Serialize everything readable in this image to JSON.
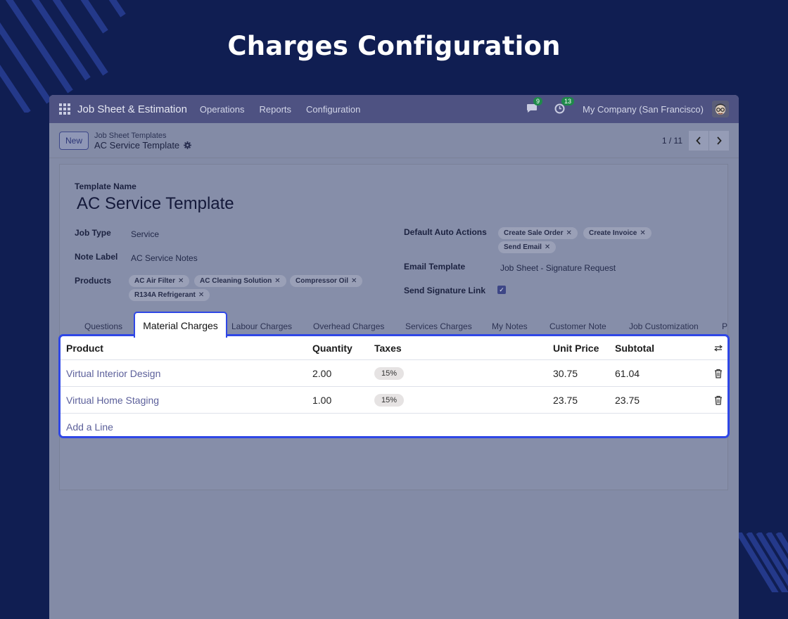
{
  "headline": "Charges Configuration",
  "navbar": {
    "app_name": "Job Sheet & Estimation",
    "menu": [
      "Operations",
      "Reports",
      "Configuration"
    ],
    "messages_count": "9",
    "activities_count": "13",
    "company": "My Company (San Francisco)"
  },
  "control": {
    "new_label": "New",
    "breadcrumb_parent": "Job Sheet Templates",
    "breadcrumb_current": "AC Service Template",
    "pager": "1 / 11"
  },
  "form": {
    "template_name_label": "Template Name",
    "template_name": "AC Service Template",
    "job_type_label": "Job Type",
    "job_type": "Service",
    "note_label_label": "Note Label",
    "note_label": "AC Service Notes",
    "products_label": "Products",
    "products": [
      "AC Air Filter",
      "AC Cleaning Solution",
      "Compressor Oil",
      "R134A Refrigerant"
    ],
    "default_auto_actions_label": "Default Auto Actions",
    "auto_actions": [
      "Create Sale Order",
      "Create Invoice",
      "Send Email"
    ],
    "email_template_label": "Email Template",
    "email_template": "Job Sheet - Signature Request",
    "send_signature_label": "Send Signature Link",
    "send_signature_checked": true
  },
  "tabs": [
    "Questions",
    "Material Charges",
    "Labour Charges",
    "Overhead Charges",
    "Services Charges",
    "My Notes",
    "Customer Note",
    "Job Customization",
    "P"
  ],
  "lines": {
    "columns": [
      "Product",
      "Quantity",
      "Taxes",
      "Unit Price",
      "Subtotal"
    ],
    "rows": [
      {
        "product": "Virtual Interior Design",
        "quantity": "2.00",
        "tax": "15%",
        "unit_price": "30.75",
        "subtotal": "61.04"
      },
      {
        "product": "Virtual Home Staging",
        "quantity": "1.00",
        "tax": "15%",
        "unit_price": "23.75",
        "subtotal": "23.75"
      }
    ],
    "add_line": "Add a Line"
  }
}
